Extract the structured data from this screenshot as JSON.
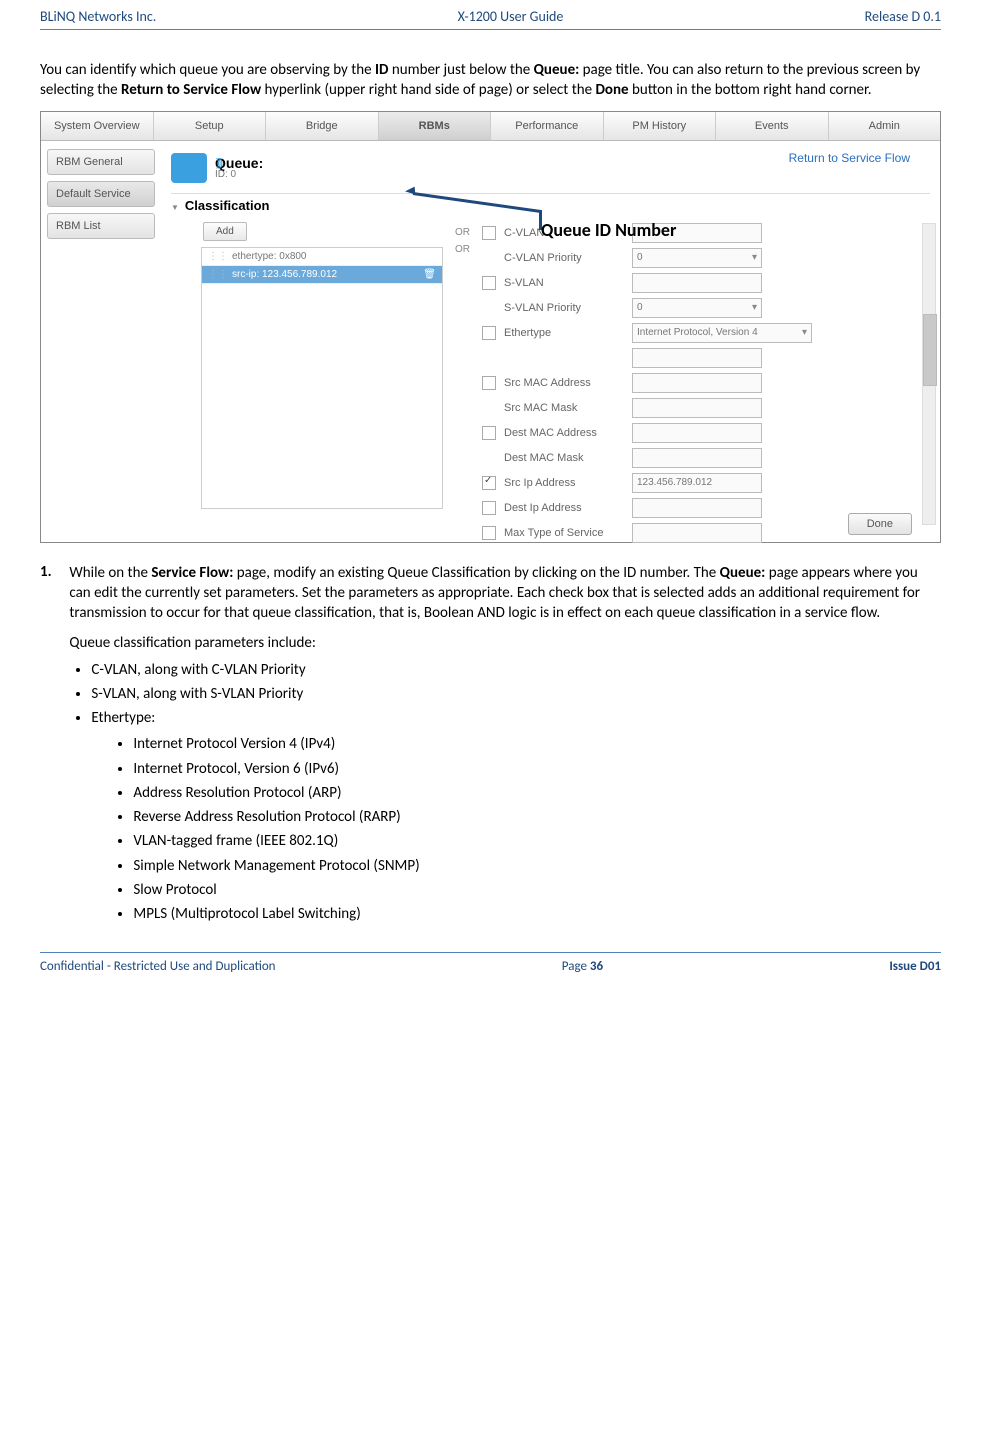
{
  "header": {
    "left": "BLiNQ Networks Inc.",
    "center": "X-1200 User Guide",
    "right": "Release D 0.1"
  },
  "intro": {
    "pre": "You can identify which queue you are observing by the ",
    "b1": "ID",
    "mid1": " number just below the ",
    "b2": "Queue:",
    "mid2": " page title. You can also return to the previous screen by selecting the ",
    "b3": "Return to Service Flow",
    "mid3": " hyperlink (upper right hand side of page) or select the ",
    "b4": "Done",
    "end": " button in the bottom right hand corner."
  },
  "annotation": "Queue ID Number",
  "screenshot": {
    "tabs": [
      "System Overview",
      "Setup",
      "Bridge",
      "RBMs",
      "Performance",
      "PM History",
      "Events",
      "Admin"
    ],
    "active_tab_index": 3,
    "side_buttons": [
      "RBM General",
      "Default Service",
      "RBM List"
    ],
    "active_side_index": 1,
    "queue_title": "Queue:",
    "queue_sub": "ID: 0",
    "return_link": "Return to Service Flow",
    "section": "Classification",
    "add_label": "Add",
    "rules": [
      {
        "text": "ethertype: 0x800",
        "selected": false
      },
      {
        "text": "src-ip: 123.456.789.012",
        "selected": true
      }
    ],
    "or_label": "OR",
    "fields": [
      {
        "cb": true,
        "checked": false,
        "label": "C-VLAN",
        "input": "",
        "dd": false
      },
      {
        "cb": false,
        "checked": false,
        "label": "C-VLAN Priority",
        "input": "0",
        "dd": true
      },
      {
        "cb": true,
        "checked": false,
        "label": "S-VLAN",
        "input": "",
        "dd": false
      },
      {
        "cb": false,
        "checked": false,
        "label": "S-VLAN Priority",
        "input": "0",
        "dd": true
      },
      {
        "cb": true,
        "checked": false,
        "label": "Ethertype",
        "input": "Internet Protocol, Version 4",
        "dd": true,
        "wide": true
      },
      {
        "cb": false,
        "checked": false,
        "label": "",
        "input": "",
        "dd": false
      },
      {
        "cb": true,
        "checked": false,
        "label": "Src MAC Address",
        "input": "",
        "dd": false
      },
      {
        "cb": false,
        "checked": false,
        "label": "Src MAC Mask",
        "input": "",
        "dd": false
      },
      {
        "cb": true,
        "checked": false,
        "label": "Dest MAC Address",
        "input": "",
        "dd": false
      },
      {
        "cb": false,
        "checked": false,
        "label": "Dest MAC Mask",
        "input": "",
        "dd": false
      },
      {
        "cb": true,
        "checked": true,
        "label": "Src Ip Address",
        "input": "123.456.789.012",
        "dd": false
      },
      {
        "cb": true,
        "checked": false,
        "label": "Dest Ip Address",
        "input": "",
        "dd": false
      },
      {
        "cb": true,
        "checked": false,
        "label": "Max Type of Service",
        "input": "",
        "dd": false
      }
    ],
    "done": "Done"
  },
  "step1": {
    "num": "1.",
    "pre": "While on the ",
    "b1": "Service Flow:",
    "mid1": " page, modify an existing Queue Classification by clicking on the ID number. The ",
    "b2": "Queue:",
    "end": " page appears where you can edit the currently set parameters. Set the parameters as appropriate. Each check box that is selected adds an additional requirement for transmission to occur for that queue classification, that is, Boolean AND logic is in effect on each queue classification in a service flow.",
    "line2": "Queue classification parameters include:",
    "bullets": [
      "C-VLAN, along with C-VLAN Priority",
      "S-VLAN, along with S-VLAN Priority",
      "Ethertype:"
    ],
    "sub_bullets": [
      "Internet Protocol Version 4 (IPv4)",
      "Internet Protocol, Version 6 (IPv6)",
      "Address Resolution Protocol (ARP)",
      "Reverse Address Resolution Protocol (RARP)",
      "VLAN-tagged frame (IEEE 802.1Q)",
      "Simple Network Management Protocol (SNMP)",
      "Slow Protocol",
      "MPLS (Multiprotocol Label Switching)"
    ]
  },
  "footer": {
    "left": "Confidential - Restricted Use and Duplication",
    "page_label": "Page ",
    "page_num": "36",
    "issue": "Issue D01"
  }
}
